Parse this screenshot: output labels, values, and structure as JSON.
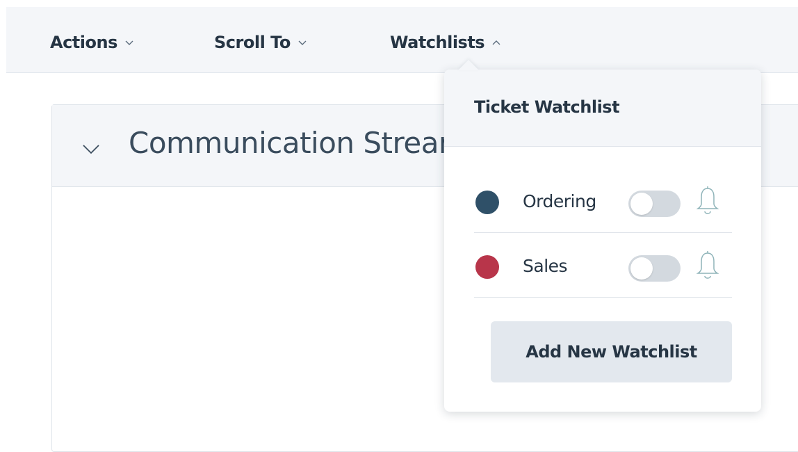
{
  "toolbar": {
    "actions_label": "Actions",
    "scroll_to_label": "Scroll To",
    "watchlists_label": "Watchlists"
  },
  "card": {
    "title": "Communication Stream"
  },
  "watchlist_dropdown": {
    "title": "Ticket Watchlist",
    "items": [
      {
        "label": "Ordering",
        "color": "#2f5068",
        "enabled": false
      },
      {
        "label": "Sales",
        "color": "#b8354a",
        "enabled": false
      }
    ],
    "add_button_label": "Add New Watchlist"
  },
  "colors": {
    "toolbar_bg": "#f4f6f9",
    "text": "#263544",
    "toggle_off": "#d3d9df",
    "bell": "#8fb4b9",
    "button_bg": "#e3e8ee"
  },
  "icons": {
    "menu_closed": "chevron-down-icon",
    "menu_open": "chevron-up-icon",
    "collapse": "chevron-down-icon",
    "notification": "bell-icon"
  }
}
